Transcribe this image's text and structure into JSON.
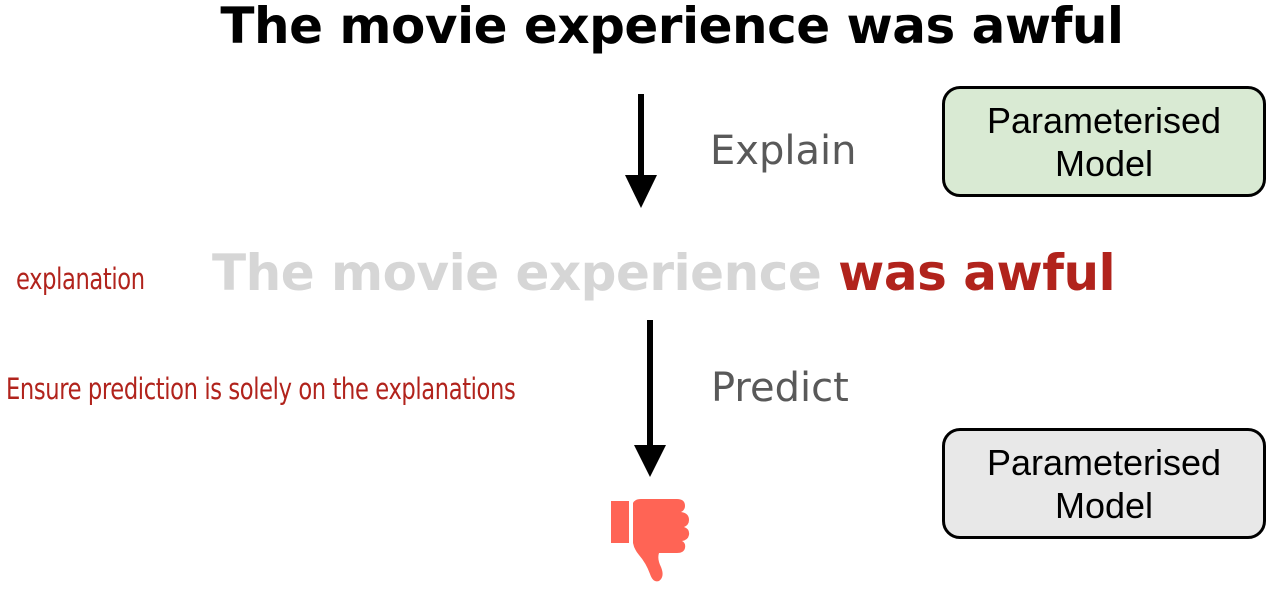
{
  "input_sentence": "The movie experience was awful",
  "explained_sentence": {
    "faded_part": "The movie experience",
    "highlighted_part": "was awful"
  },
  "steps": {
    "explain_label": "Explain",
    "predict_label": "Predict"
  },
  "annotations": {
    "explanation_label": "explanation",
    "constraint_note": "Ensure prediction is solely on the explanations"
  },
  "models": {
    "explainer": {
      "line1": "Parameterised",
      "line2": "Model",
      "fill_color": "#d9ead3"
    },
    "predictor": {
      "line1": "Parameterised",
      "line2": "Model",
      "fill_color": "#e8e8e8"
    }
  },
  "output": {
    "icon": "thumbs-down-icon",
    "color": "#ff6455"
  },
  "colors": {
    "highlight": "#b1231c",
    "faded_text": "#d6d6d6",
    "step_text": "#595959"
  }
}
